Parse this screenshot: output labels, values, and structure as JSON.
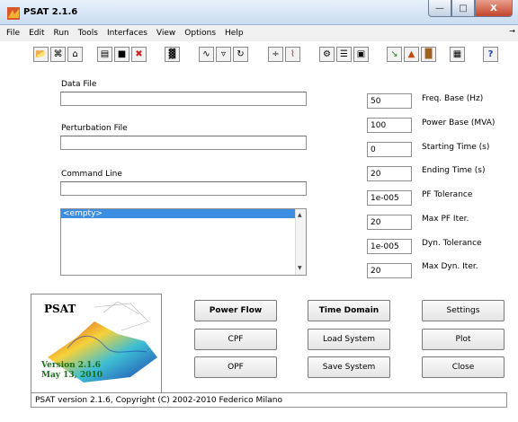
{
  "window": {
    "title": "PSAT 2.1.6",
    "min_symbol": "—",
    "max_symbol": "□",
    "close_symbol": "X"
  },
  "menu": {
    "items": [
      "File",
      "Edit",
      "Run",
      "Tools",
      "Interfaces",
      "View",
      "Options",
      "Help"
    ],
    "overflow_symbol": "→"
  },
  "toolbar": {
    "icons": [
      {
        "name": "open-folder-icon",
        "glyph": "📂"
      },
      {
        "name": "network-icon",
        "glyph": "⌘"
      },
      {
        "name": "home-icon",
        "glyph": "⌂"
      },
      {
        "name": "document-icon",
        "glyph": "▤"
      },
      {
        "name": "save-icon",
        "glyph": "■"
      },
      {
        "name": "stop-icon",
        "glyph": "✖"
      },
      {
        "name": "matrix-icon",
        "glyph": "▓"
      },
      {
        "name": "sine-icon",
        "glyph": "∿"
      },
      {
        "name": "graph-icon",
        "glyph": "▿"
      },
      {
        "name": "opf-icon",
        "glyph": "↻"
      },
      {
        "name": "fraction-icon",
        "glyph": "÷"
      },
      {
        "name": "wave-icon",
        "glyph": "⌇"
      },
      {
        "name": "settings-icon",
        "glyph": "⚙"
      },
      {
        "name": "report-icon",
        "glyph": "☰"
      },
      {
        "name": "image-icon",
        "glyph": "▣"
      },
      {
        "name": "arrow-icon",
        "glyph": "↘"
      },
      {
        "name": "matlab-icon",
        "glyph": "▲"
      },
      {
        "name": "library-icon",
        "glyph": "█"
      },
      {
        "name": "book-icon",
        "glyph": "▦"
      },
      {
        "name": "help-icon",
        "glyph": "?"
      }
    ]
  },
  "files": {
    "data_label": "Data File",
    "data_value": "",
    "perturbation_label": "Perturbation File",
    "perturbation_value": "",
    "command_label": "Command Line",
    "command_value": ""
  },
  "messages": {
    "items": [
      "<empty>"
    ],
    "scroll_up": "▲",
    "scroll_down": "▼"
  },
  "params": [
    {
      "value": "50",
      "label": "Freq. Base (Hz)"
    },
    {
      "value": "100",
      "label": "Power Base (MVA)"
    },
    {
      "value": "0",
      "label": "Starting Time (s)"
    },
    {
      "value": "20",
      "label": "Ending Time (s)"
    },
    {
      "value": "1e-005",
      "label": "PF Tolerance"
    },
    {
      "value": "20",
      "label": "Max PF Iter."
    },
    {
      "value": "1e-005",
      "label": "Dyn. Tolerance"
    },
    {
      "value": "20",
      "label": "Max Dyn. Iter."
    }
  ],
  "buttons": {
    "power_flow": "Power Flow",
    "time_domain": "Time Domain",
    "settings": "Settings",
    "cpf": "CPF",
    "load_system": "Load System",
    "plot": "Plot",
    "opf": "OPF",
    "save_system": "Save System",
    "close": "Close"
  },
  "logo": {
    "title": "PSAT",
    "version": "Version 2.1.6",
    "date": "May 13, 2010"
  },
  "status": "PSAT version 2.1.6, Copyright (C) 2002-2010 Federico Milano"
}
